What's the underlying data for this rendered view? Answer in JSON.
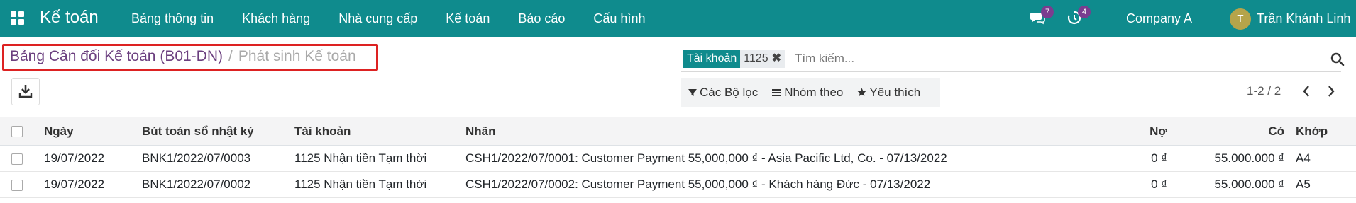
{
  "navbar": {
    "brand": "Kế toán",
    "menu": [
      "Bảng thông tin",
      "Khách hàng",
      "Nhà cung cấp",
      "Kế toán",
      "Báo cáo",
      "Cấu hình"
    ],
    "messages_count": "7",
    "activities_count": "4",
    "company": "Company A",
    "user_initial": "T",
    "user_name": "Trần Khánh Linh"
  },
  "breadcrumb": {
    "parent": "Bảng Cân đối Kế toán (B01-DN)",
    "separator": "/",
    "current": "Phát sinh Kế toán"
  },
  "search": {
    "facet_label": "Tài khoản",
    "facet_value": "1125",
    "facet_remove": "✖",
    "placeholder": "Tìm kiếm..."
  },
  "filters": {
    "filters_label": "Các Bộ lọc",
    "group_label": "Nhóm theo",
    "favorites_label": "Yêu thích"
  },
  "pager": {
    "text": "1-2 / 2"
  },
  "table": {
    "headers": {
      "date": "Ngày",
      "move": "Bút toán sổ nhật ký",
      "account": "Tài khoản",
      "label": "Nhãn",
      "debit": "Nợ",
      "credit": "Có",
      "matching": "Khớp"
    },
    "rows": [
      {
        "date": "19/07/2022",
        "move": "BNK1/2022/07/0003",
        "account": "1125 Nhận tiền Tạm thời",
        "label": "CSH1/2022/07/0001: Customer Payment 55,000,000 ₫ - Asia Pacific Ltd, Co. - 07/13/2022",
        "debit": "0 ₫",
        "credit": "55.000.000 ₫",
        "matching": "A4"
      },
      {
        "date": "19/07/2022",
        "move": "BNK1/2022/07/0002",
        "account": "1125 Nhận tiền Tạm thời",
        "label": "CSH1/2022/07/0002: Customer Payment 55,000,000 ₫ - Khách hàng Đức - 07/13/2022",
        "debit": "0 ₫",
        "credit": "55.000.000 ₫",
        "matching": "A5"
      }
    ]
  },
  "colors": {
    "navbar": "#0f8b8d",
    "breadcrumb_link": "#6b3f7f",
    "highlight_box": "#dd2222",
    "badge": "#7a3d8f"
  }
}
